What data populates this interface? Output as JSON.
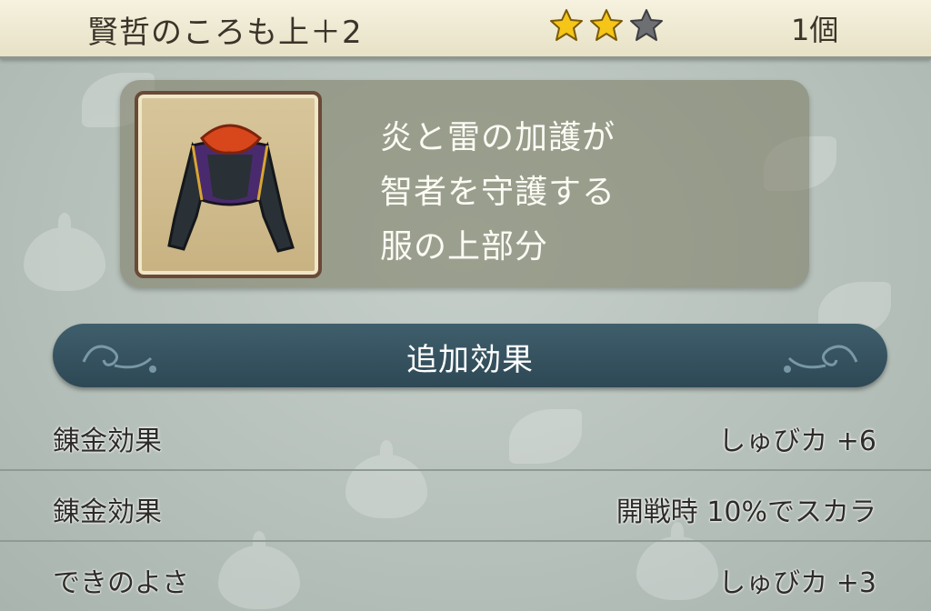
{
  "header": {
    "item_name": "賢哲のころも上＋2",
    "rating": 2,
    "rating_max": 3,
    "quantity": "1個",
    "star_color_filled": "#f5c518",
    "star_color_empty": "#6d6f73"
  },
  "item": {
    "icon": "jacket-icon",
    "description_lines": [
      "炎と雷の加護が",
      "智者を守護する",
      "服の上部分"
    ]
  },
  "section": {
    "title": "追加効果"
  },
  "effects": [
    {
      "label": "錬金効果",
      "value": "しゅびカ +6"
    },
    {
      "label": "錬金効果",
      "value": "開戦時 10%でスカラ"
    },
    {
      "label": "できのよさ",
      "value": "しゅびカ +3"
    }
  ],
  "colors": {
    "banner": "#34515f",
    "header_bg": "#f2eed8"
  }
}
